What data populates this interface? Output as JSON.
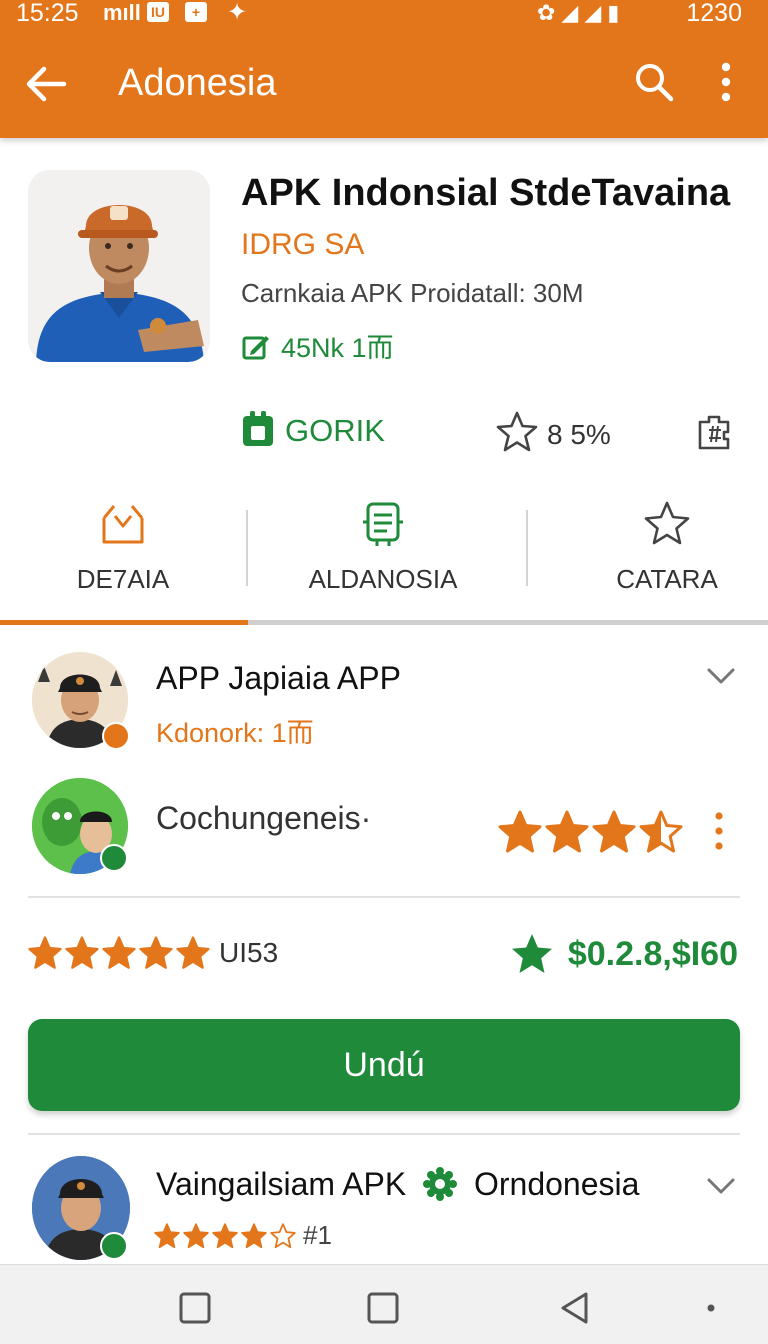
{
  "status_bar": {
    "time": "15:25",
    "signal": "mıll",
    "left_badge_1": "IU",
    "left_badge_2": "+",
    "right_text": "1230"
  },
  "app_bar": {
    "title": "Adonesia"
  },
  "app": {
    "name": "APK Indonsial StdeTavaina",
    "publisher": "IDRG SA",
    "meta": "Carnkaia APK Proidatall: 30M",
    "downloads": "45Nk 1而",
    "genre": "GORIK",
    "rating": "8 5%"
  },
  "tabs": [
    {
      "label": "DE7AIA"
    },
    {
      "label": "ALDANOSIA"
    },
    {
      "label": "CATARA"
    }
  ],
  "list": {
    "item1": {
      "title": "APP Japiaia APP",
      "subtitle": "Kdonork: 1而"
    },
    "item2": {
      "title": "Cochungeneis·",
      "stars": 3.5
    },
    "rating_line": {
      "stars": 5,
      "label": "UI53",
      "price": "$0.2.8,$I60"
    },
    "download_button": "Undú",
    "item3": {
      "title_a": "Vaingailsiam APK",
      "title_b": "Orndonesia",
      "stars": 4,
      "rank": "#1"
    }
  },
  "colors": {
    "accent": "#e3761b",
    "green": "#1e8a3a"
  },
  "icons": [
    "back-arrow-icon",
    "search-icon",
    "more-vert-icon",
    "edit-icon",
    "bag-icon",
    "star-outline-icon",
    "puzzle-icon",
    "download-box-icon",
    "list-doc-icon",
    "chevron-down-icon",
    "gear-icon"
  ]
}
